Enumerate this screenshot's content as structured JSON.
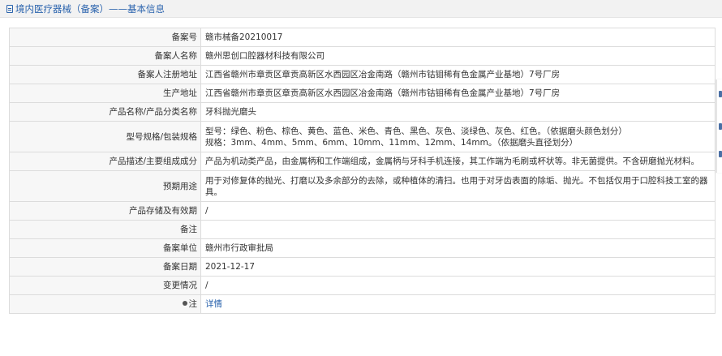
{
  "header": {
    "title": "境内医疗器械（备案）——基本信息"
  },
  "rows": [
    {
      "label": "备案号",
      "value": "赣市械备20210017"
    },
    {
      "label": "备案人名称",
      "value": "赣州思创口腔器材科技有限公司"
    },
    {
      "label": "备案人注册地址",
      "value": "江西省赣州市章贡区章贡高新区水西园区冶金南路（赣州市钴钼稀有色金属产业基地）7号厂房"
    },
    {
      "label": "生产地址",
      "value": "江西省赣州市章贡区章贡高新区水西园区冶金南路（赣州市钴钼稀有色金属产业基地）7号厂房"
    },
    {
      "label": "产品名称/产品分类名称",
      "value": "牙科抛光磨头"
    },
    {
      "label": "型号规格/包装规格",
      "value_lines": [
        "型号：绿色、粉色、棕色、黄色、蓝色、米色、青色、黑色、灰色、淡绿色、灰色、红色。（依据磨头颜色划分）",
        "规格：3mm、4mm、5mm、6mm、10mm、11mm、12mm、14mm。（依据磨头直径划分）"
      ]
    },
    {
      "label": "产品描述/主要组成成分",
      "value": "产品为机动类产品，由金属柄和工作端组成，金属柄与牙科手机连接，其工作端为毛刷或杯状等。非无菌提供。不含研磨抛光材料。"
    },
    {
      "label": "预期用途",
      "value": "用于对修复体的抛光、打磨以及多余部分的去除，或种植体的清扫。也用于对牙齿表面的除垢、抛光。不包括仅用于口腔科技工室的器具。"
    },
    {
      "label": "产品存储及有效期",
      "value": "/"
    },
    {
      "label": "备注",
      "value": ""
    },
    {
      "label": "备案单位",
      "value": "赣州市行政审批局"
    },
    {
      "label": "备案日期",
      "value": "2021-12-17"
    },
    {
      "label": "变更情况",
      "value": "/"
    },
    {
      "label": "注",
      "value": "详情"
    }
  ]
}
